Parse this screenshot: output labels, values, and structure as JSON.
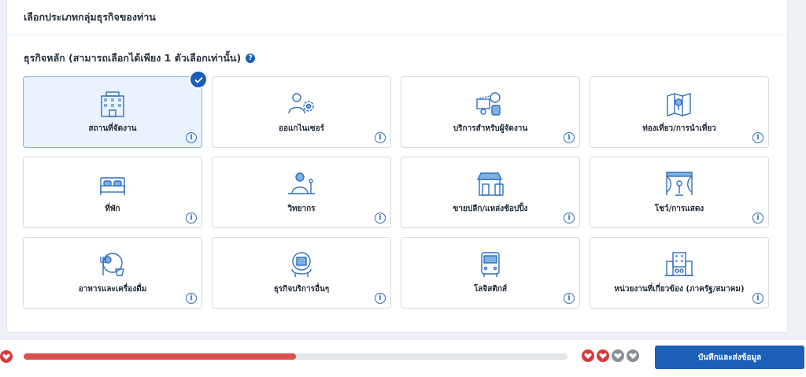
{
  "header": {
    "title": "เลือกประเภทกลุ่มธุรกิจของท่าน"
  },
  "section": {
    "title": "ธุรกิจหลัก (สามารถเลือกได้เพียง 1 ตัวเลือกเท่านั้น)",
    "help_icon": "question-icon"
  },
  "cards": [
    {
      "label": "สถานที่จัดงาน",
      "icon": "building-icon",
      "selected": true
    },
    {
      "label": "ออแกไนเซอร์",
      "icon": "organizer-icon",
      "selected": false
    },
    {
      "label": "บริการสำหรับผู้จัดงาน",
      "icon": "event-services-icon",
      "selected": false
    },
    {
      "label": "ท่องเที่ยว/การนำเที่ยว",
      "icon": "map-icon",
      "selected": false
    },
    {
      "label": "ที่พัก",
      "icon": "bed-icon",
      "selected": false
    },
    {
      "label": "วิทยากร",
      "icon": "speaker-icon",
      "selected": false
    },
    {
      "label": "ขายปลีก/แหล่งช้อปปิ้ง",
      "icon": "shop-icon",
      "selected": false
    },
    {
      "label": "โชว์/การแสดง",
      "icon": "stage-icon",
      "selected": false
    },
    {
      "label": "อาหารและเครื่องดื่ม",
      "icon": "food-drink-icon",
      "selected": false
    },
    {
      "label": "ธุรกิจบริการอื่นๆ",
      "icon": "service-icon",
      "selected": false
    },
    {
      "label": "โลจิสติกส์",
      "icon": "bus-icon",
      "selected": false
    },
    {
      "label": "หน่วยงานที่เกี่ยวข้อง (ภาครัฐ/สมาคม)",
      "icon": "government-icon",
      "selected": false
    }
  ],
  "progress": {
    "fraction": 0.5
  },
  "lives": {
    "filled": 2,
    "total": 4
  },
  "colors": {
    "accent": "#1b5fb8",
    "progress": "#d9514e",
    "heart": "#d63a3a",
    "heart_empty": "#8a8f96"
  },
  "actions": {
    "submit_label": "บันทึกและส่งข้อมูล"
  }
}
